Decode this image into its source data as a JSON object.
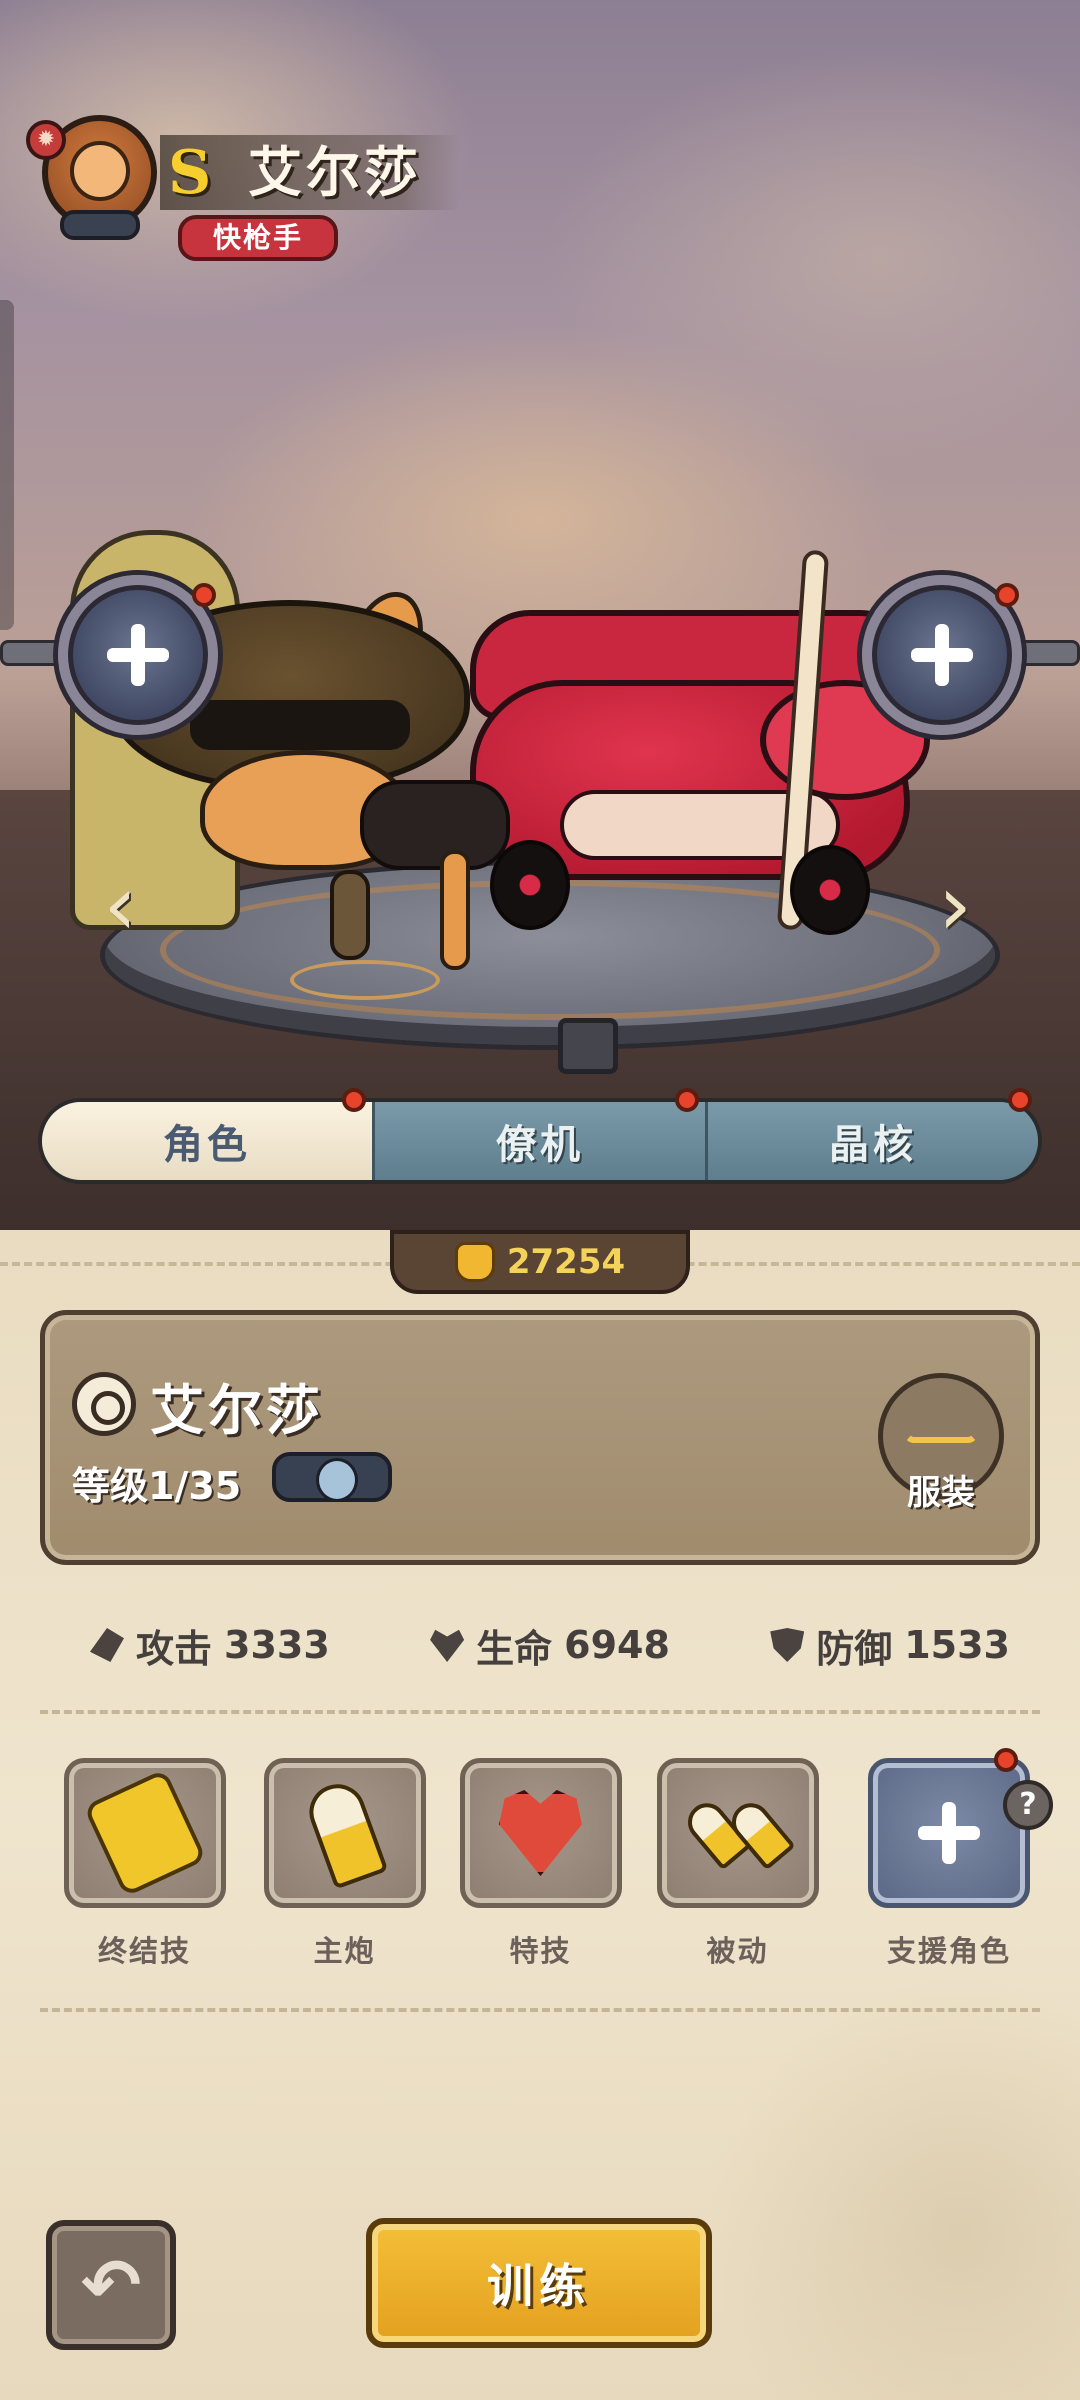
{
  "header": {
    "rank": "S",
    "hero_name": "艾尔莎",
    "class_tag": "快枪手"
  },
  "tabs": [
    {
      "label": "角色",
      "active": true,
      "has_notice": true
    },
    {
      "label": "僚机",
      "active": false,
      "has_notice": true
    },
    {
      "label": "晶核",
      "active": false,
      "has_notice": true
    }
  ],
  "power": {
    "value": "27254",
    "icon": "fist-icon"
  },
  "card": {
    "name": "艾尔莎",
    "level": "等级1/35",
    "outfit_label": "服装"
  },
  "stats": [
    {
      "icon": "attack-icon",
      "label": "攻击",
      "value": "3333"
    },
    {
      "icon": "life-icon",
      "label": "生命",
      "value": "6948"
    },
    {
      "icon": "defense-icon",
      "label": "防御",
      "value": "1533"
    }
  ],
  "skills": [
    {
      "label": "终结技",
      "icon": "golden-gun-icon"
    },
    {
      "label": "主炮",
      "icon": "bullet-icon"
    },
    {
      "label": "特技",
      "icon": "heart-icon"
    },
    {
      "label": "被动",
      "icon": "twin-bullets-icon"
    },
    {
      "label": "支援角色",
      "icon": "plus-icon"
    }
  ],
  "help_symbol": "?",
  "navigation": {
    "back_symbol": "↶",
    "prev_symbol": "‹",
    "next_symbol": "›"
  },
  "actions": {
    "train_label": "训练"
  },
  "colors": {
    "accent_gold": "#f4bf38",
    "tab_active": "#faf2e0",
    "tab_inactive": "#6e8e9d",
    "notice_red": "#e8432b",
    "class_tag_red": "#c7343d"
  }
}
